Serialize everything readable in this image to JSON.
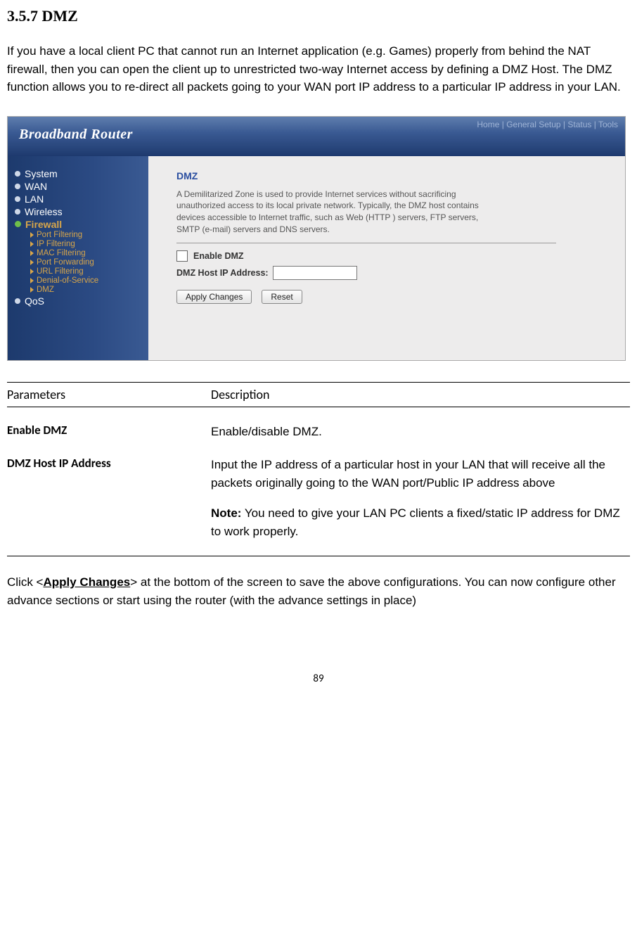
{
  "section": {
    "number": "3.5.7",
    "title": "DMZ"
  },
  "intro": "If you have a local client PC that cannot run an Internet application (e.g. Games) properly from behind the NAT firewall, then you can open the client up to unrestricted two-way Internet access by defining a DMZ Host. The DMZ function allows you to re-direct all packets going to your WAN port IP address to a particular IP address in your LAN.",
  "router_ui": {
    "brand": "Broadband Router",
    "topnav": [
      "Home",
      "General Setup",
      "Status",
      "Tools"
    ],
    "sidebar": {
      "items": [
        {
          "label": "System",
          "active": false
        },
        {
          "label": "WAN",
          "active": false
        },
        {
          "label": "LAN",
          "active": false
        },
        {
          "label": "Wireless",
          "active": false
        },
        {
          "label": "Firewall",
          "active": true
        },
        {
          "label": "QoS",
          "active": false
        }
      ],
      "firewall_sub": [
        "Port Filtering",
        "IP Filtering",
        "MAC Filtering",
        "Port Forwarding",
        "URL Filtering",
        "Denial-of-Service",
        "DMZ"
      ]
    },
    "content": {
      "heading": "DMZ",
      "desc": "A Demilitarized Zone is used to provide Internet services without sacrificing unauthorized access to its local private network. Typically, the DMZ host contains devices accessible to Internet traffic, such as Web (HTTP ) servers, FTP servers, SMTP (e-mail) servers and DNS servers.",
      "enable_label": "Enable DMZ",
      "ip_label": "DMZ Host IP Address:",
      "apply_btn": "Apply Changes",
      "reset_btn": "Reset"
    }
  },
  "param_table": {
    "col1_header": "Parameters",
    "col2_header": "Description",
    "rows": [
      {
        "name": "Enable DMZ",
        "desc": "Enable/disable DMZ."
      },
      {
        "name": "DMZ Host IP Address",
        "desc": "Input the IP address of a particular host in your LAN that will receive all the packets originally going to the WAN port/Public IP address above",
        "note_label": "Note:",
        "note_text": " You need to give your LAN PC clients a fixed/static IP address for DMZ to work properly."
      }
    ]
  },
  "closing": {
    "pre": "Click <",
    "bold": "Apply Changes",
    "post": "> at the bottom of the screen to save the above configurations. You can now configure other advance sections or start using the router (with the advance settings in place)"
  },
  "page_number": "89"
}
